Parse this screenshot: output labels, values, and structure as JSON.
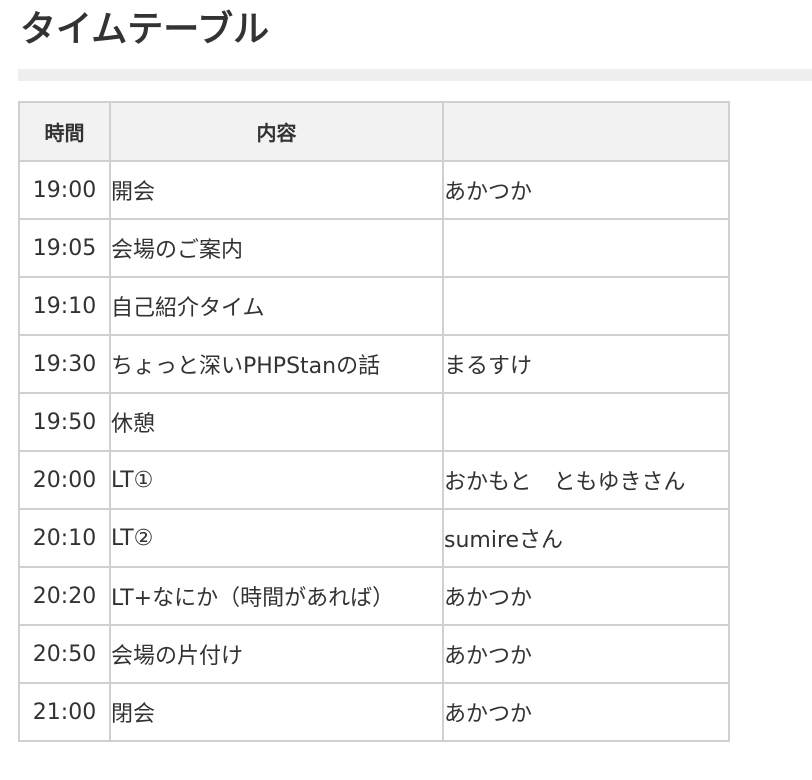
{
  "page": {
    "title": "タイムテーブル"
  },
  "timetable": {
    "headers": {
      "time": "時間",
      "content": "内容",
      "person": ""
    },
    "rows": [
      {
        "time": "19:00",
        "content": "開会",
        "person": "あかつか"
      },
      {
        "time": "19:05",
        "content": "会場のご案内",
        "person": ""
      },
      {
        "time": "19:10",
        "content": "自己紹介タイム",
        "person": ""
      },
      {
        "time": "19:30",
        "content": "ちょっと深いPHPStanの話",
        "person": "まるすけ"
      },
      {
        "time": "19:50",
        "content": "休憩",
        "person": ""
      },
      {
        "time": "20:00",
        "content": "LT①",
        "person": "おかもと　ともゆきさん"
      },
      {
        "time": "20:10",
        "content": "LT②",
        "person": "sumireさん"
      },
      {
        "time": "20:20",
        "content": "LT+なにか（時間があれば）",
        "person": "あかつか"
      },
      {
        "time": "20:50",
        "content": "会場の片付け",
        "person": "あかつか"
      },
      {
        "time": "21:00",
        "content": "閉会",
        "person": "あかつか"
      }
    ]
  },
  "colors": {
    "text": "#333333",
    "rule": "#eeeeee",
    "border": "#d0d0d0",
    "header_bg": "#f2f2f2"
  }
}
